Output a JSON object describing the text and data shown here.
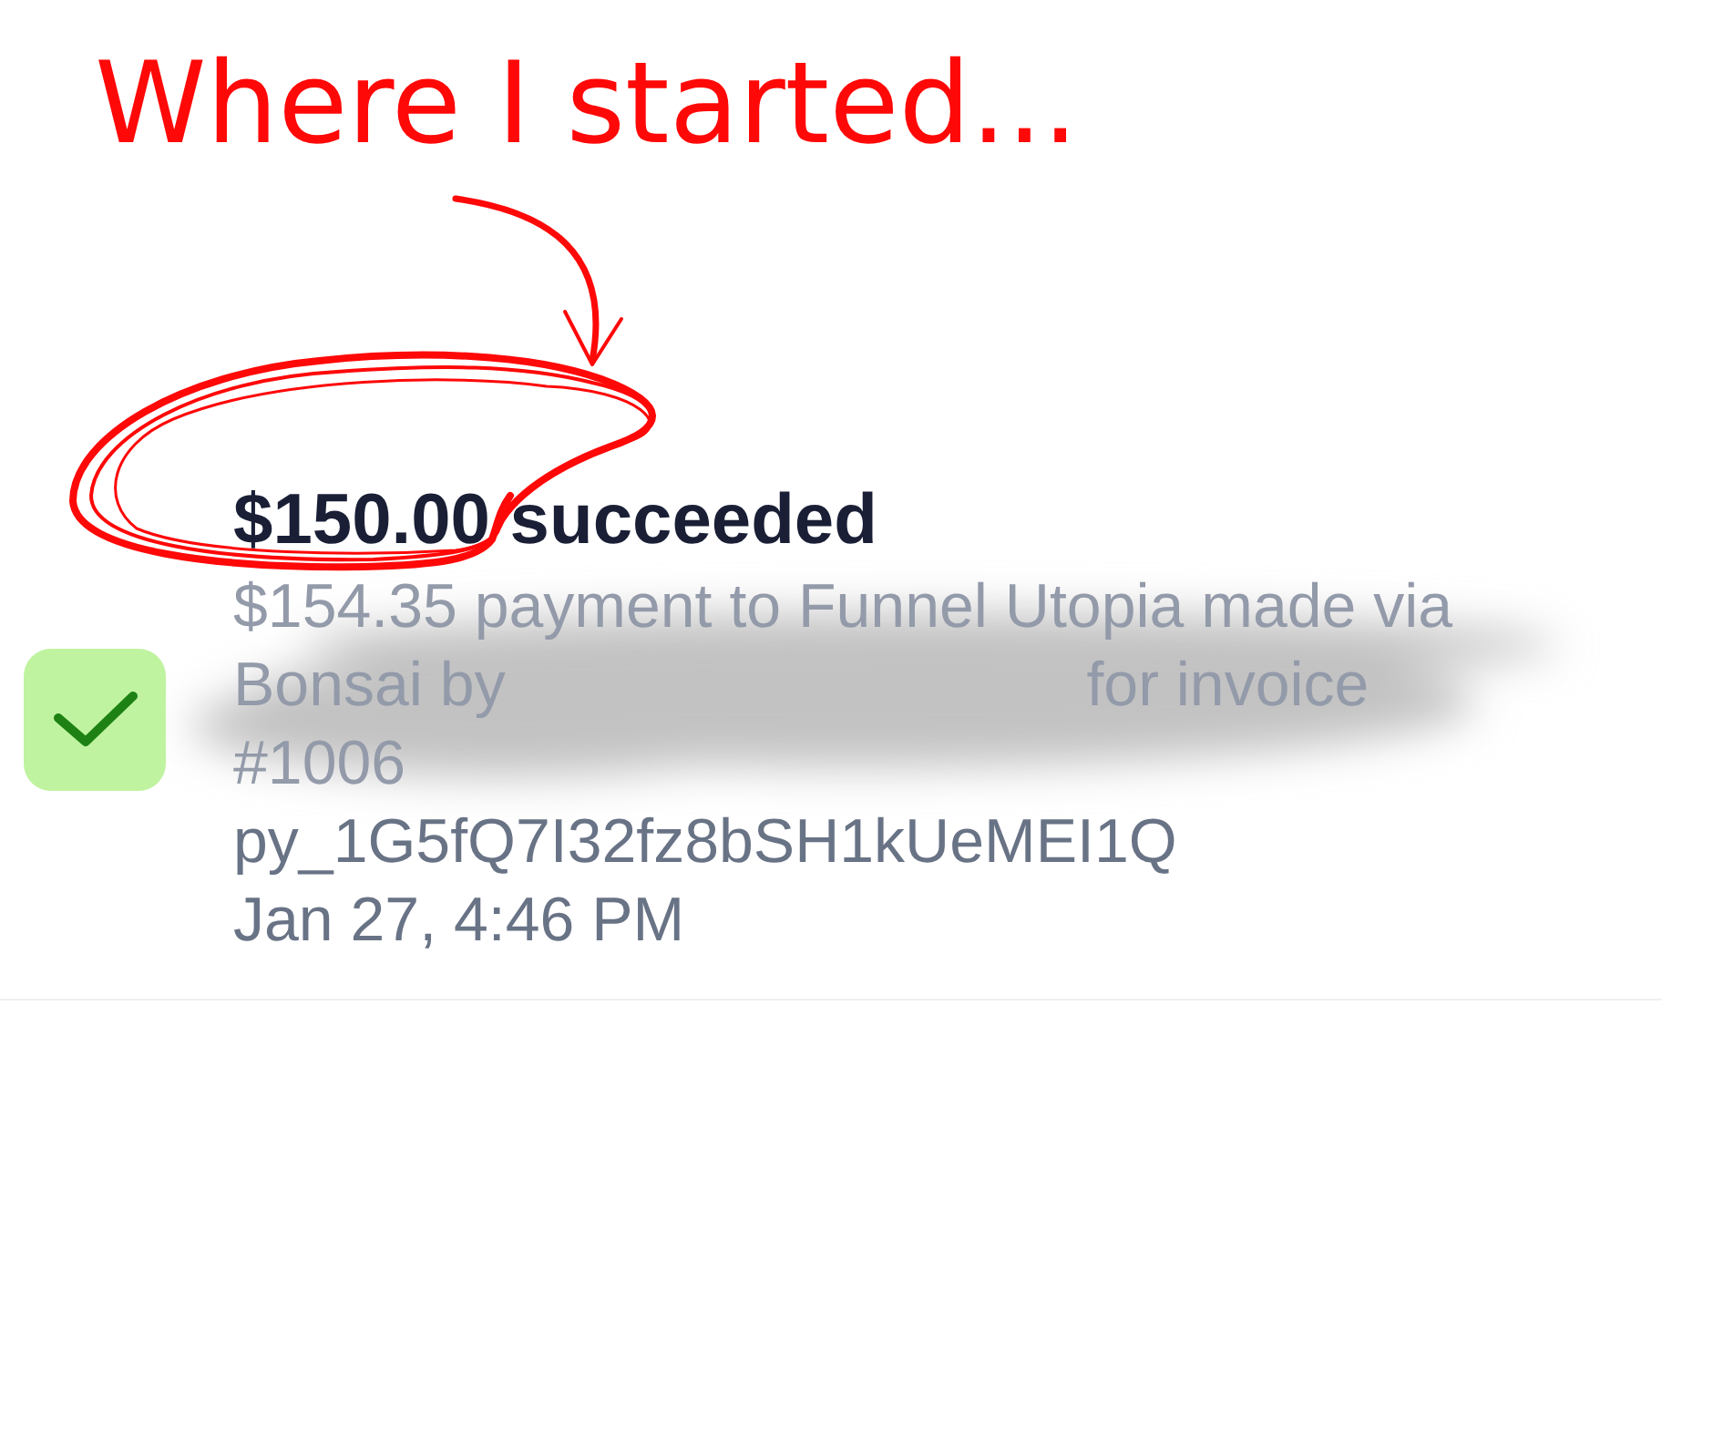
{
  "annotation": {
    "caption": "Where I started..."
  },
  "payment_event": {
    "title": "$150.00 succeeded",
    "description": {
      "before": "$154.35 payment to Funnel Utopia made via Bonsai by",
      "redacted": true,
      "after": "for invoice #1006"
    },
    "payment_id": "py_1G5fQ7I32fz8bSH1kUeMEI1Q",
    "timestamp": "Jan 27, 4:46 PM"
  }
}
